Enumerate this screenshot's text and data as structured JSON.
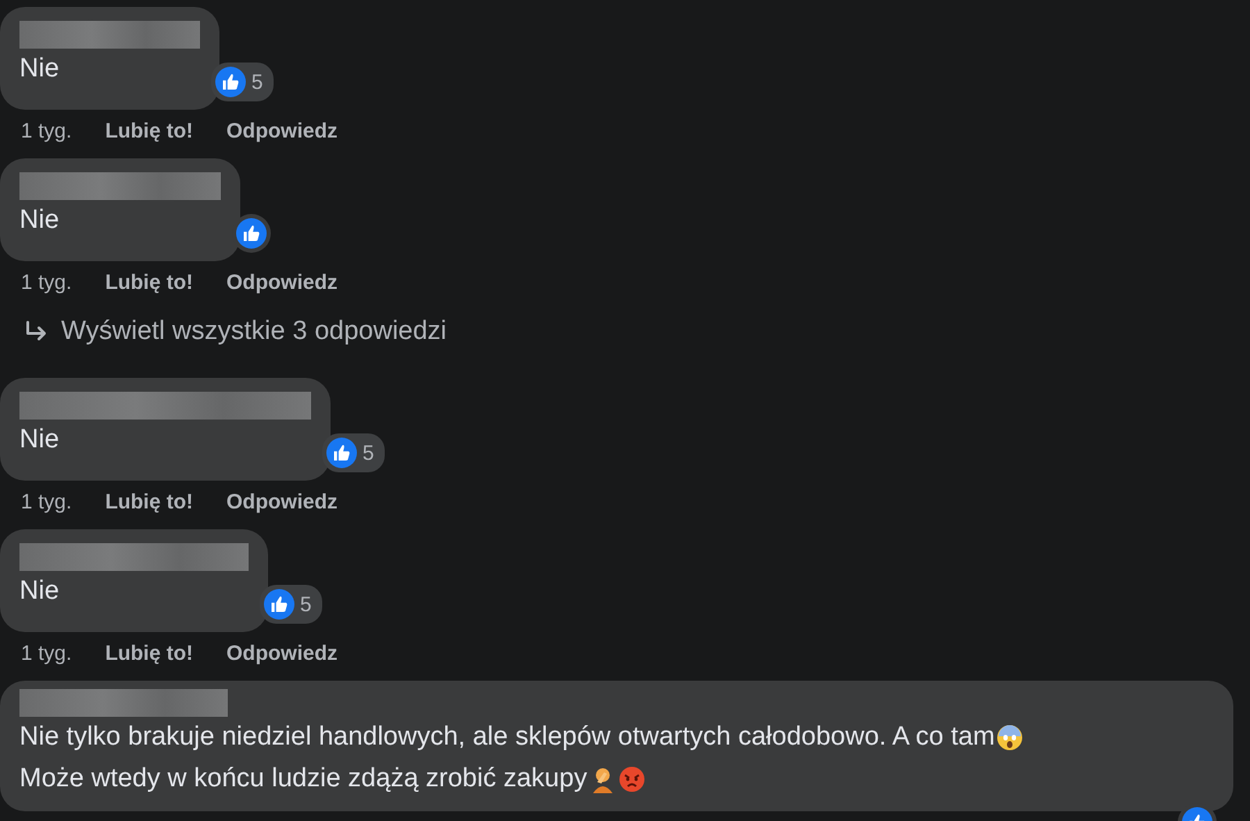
{
  "comments": [
    {
      "kind": "comment",
      "lines": [
        {
          "text": "Nie"
        }
      ],
      "reacted": true,
      "reaction_count": "5",
      "time": "1 tyg.",
      "like_label": "Lubię to!",
      "reply_label": "Odpowiedz"
    },
    {
      "kind": "comment",
      "lines": [
        {
          "text": "Nie"
        }
      ],
      "reacted": true,
      "time": "1 tyg.",
      "like_label": "Lubię to!",
      "reply_label": "Odpowiedz"
    },
    {
      "kind": "replies_link",
      "label": "Wyświetl wszystkie 3 odpowiedzi"
    },
    {
      "kind": "comment",
      "lines": [
        {
          "text": "Nie"
        }
      ],
      "reacted": true,
      "reaction_count": "5",
      "time": "1 tyg.",
      "like_label": "Lubię to!",
      "reply_label": "Odpowiedz"
    },
    {
      "kind": "comment",
      "lines": [
        {
          "text": "Nie"
        }
      ],
      "reacted": true,
      "reaction_count": "5",
      "time": "1 tyg.",
      "like_label": "Lubię to!",
      "reply_label": "Odpowiedz"
    },
    {
      "kind": "comment",
      "lines": [
        {
          "text": "Nie tylko brakuje niedziel handlowych, ale sklepów otwartych całodobowo. A co tam"
        },
        {
          "text": "Może wtedy w końcu ludzie zdążą zrobić zakupy"
        }
      ],
      "reacted": true
    }
  ]
}
